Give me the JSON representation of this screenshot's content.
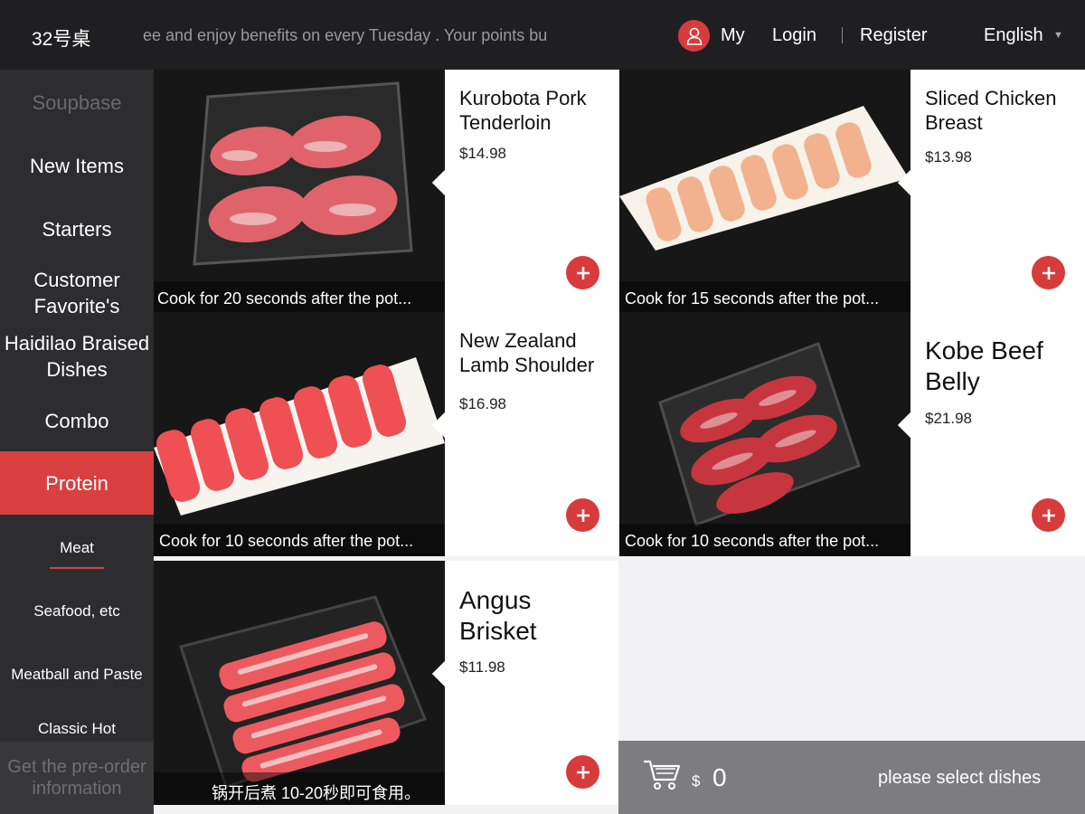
{
  "header": {
    "table_no": "32号桌",
    "marquee": "ee and enjoy benefits on every Tuesday . Your points bu",
    "my": "My",
    "login": "Login",
    "register": "Register",
    "language": "English"
  },
  "sidebar": {
    "categories": [
      {
        "label": "Soupbase"
      },
      {
        "label": "New Items"
      },
      {
        "label": "Starters"
      },
      {
        "label": "Customer Favorite's"
      },
      {
        "label": "Haidilao Braised Dishes"
      },
      {
        "label": "Combo"
      },
      {
        "label": "Protein"
      }
    ],
    "subcategories": [
      {
        "label": "Meat"
      },
      {
        "label": "Seafood, etc"
      },
      {
        "label": "Meatball and Paste"
      },
      {
        "label": "Classic Hot"
      }
    ],
    "preorder": "Get the pre-order information"
  },
  "dishes": [
    {
      "name": "Kurobota Pork Tenderloin",
      "price": "$14.98",
      "caption": "Cook for 20 seconds after the pot..."
    },
    {
      "name": "Sliced Chicken Breast",
      "price": "$13.98",
      "caption": "Cook for 15 seconds after the pot..."
    },
    {
      "name": "New Zealand Lamb Shoulder",
      "price": "$16.98",
      "caption": "Cook for 10 seconds after the pot..."
    },
    {
      "name": "Kobe Beef Belly",
      "price": "$21.98",
      "caption": "Cook for 10 seconds after the pot..."
    },
    {
      "name": "Angus Brisket",
      "price": "$11.98",
      "caption": "锅开后煮 10-20秒即可食用。"
    }
  ],
  "cart": {
    "currency": "$",
    "total": "0",
    "hint": "please select dishes"
  },
  "colors": {
    "accent": "#d73b3b",
    "header_bg": "#1f1f21",
    "sidebar_bg": "#2d2d2f",
    "cart_bg": "#7d7d7f"
  }
}
